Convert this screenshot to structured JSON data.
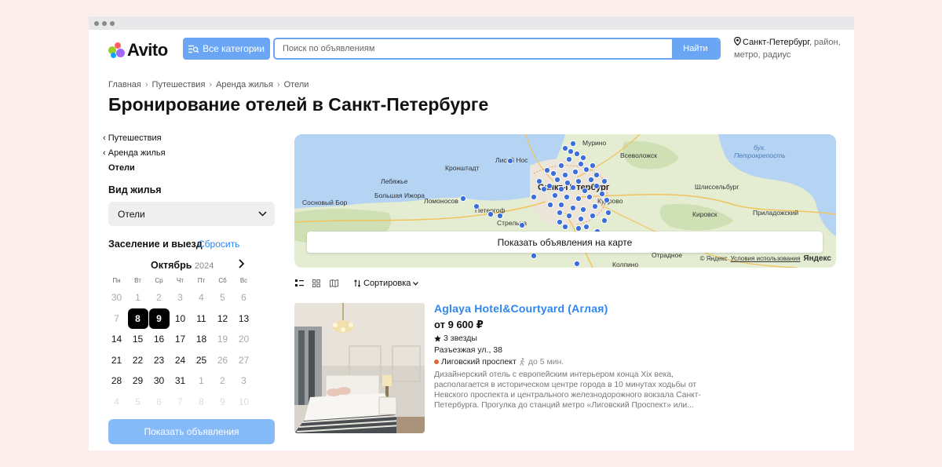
{
  "header": {
    "logo_text": "Avito",
    "categories_button": "Все категории",
    "search_placeholder": "Поиск по объявлениям",
    "search_button": "Найти",
    "location_city": "Санкт-Петербург",
    "location_rest": ", район,",
    "location_line2": "метро, радиус"
  },
  "breadcrumbs": [
    "Главная",
    "Путешествия",
    "Аренда жилья",
    "Отели"
  ],
  "page_title": "Бронирование отелей в Санкт-Петербурге",
  "sidebar": {
    "nav": [
      "Путешествия",
      "Аренда жилья"
    ],
    "current": "Отели",
    "housing_type_label": "Вид жилья",
    "housing_type_value": "Отели",
    "dates_label": "Заселение и выезд",
    "reset_label": "Сбросить",
    "calendar": {
      "month": "Октябрь",
      "year": "2024",
      "weekdays": [
        "Пн",
        "Вт",
        "Ср",
        "Чт",
        "Пт",
        "Сб",
        "Вс"
      ],
      "weeks": [
        [
          "30",
          "1",
          "2",
          "3",
          "4",
          "5",
          "6"
        ],
        [
          "7",
          "8",
          "9",
          "10",
          "11",
          "12",
          "13"
        ],
        [
          "14",
          "15",
          "16",
          "17",
          "18",
          "19",
          "20"
        ],
        [
          "21",
          "22",
          "23",
          "24",
          "25",
          "26",
          "27"
        ],
        [
          "28",
          "29",
          "30",
          "31",
          "1",
          "2",
          "3"
        ],
        [
          "4",
          "5",
          "6",
          "7",
          "8",
          "9",
          "10"
        ]
      ],
      "selected": [
        "8",
        "9"
      ]
    },
    "show_button": "Показать объявления"
  },
  "map": {
    "button": "Показать объявления на карте",
    "copyright": "© Яндекс",
    "terms": "Условия использования",
    "brand": "Яндекс",
    "labels": [
      "Мурино",
      "Всеволожск",
      "бух.",
      "Петрокрепость",
      "Лисий Нос",
      "Кронштадт",
      "Лебяжье",
      "Санкт-Петербург",
      "Шлиссельбург",
      "Сосновый Бор",
      "Большая Ижора",
      "Ломоносов",
      "Петергоф",
      "Стрельна",
      "Кудрово",
      "Кировск",
      "Приладожский",
      "Отрадное",
      "Колпино"
    ]
  },
  "toolbar": {
    "sort_label": "Сортировка"
  },
  "listing": {
    "title": "Aglaya Hotel&Courtyard (Аглая)",
    "price": "от 9 600 ₽",
    "stars": "3 звезды",
    "address": "Разъезжая ул., 38",
    "metro": "Лиговский проспект",
    "walk": "до 5 мин.",
    "description": "Дизайнерский отель с европейским интерьером конца Xix века, располагается в историческом центре города в 10 минутах ходьбы от Невского проспекта и центрального железнодорожного вокзала Санкт-Петербурга. Прогулка до станций метро «Лиговский Проспект» или..."
  },
  "colors": {
    "accent": "#6ba6f5",
    "link": "#2e86f0",
    "page_bg": "#fbeeec",
    "map_pin": "#3b6fdc"
  }
}
